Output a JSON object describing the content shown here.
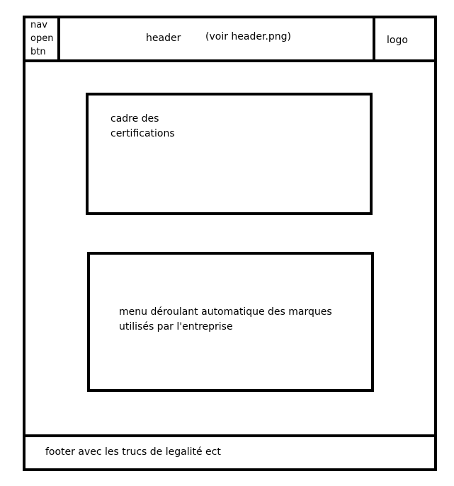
{
  "nav_button": {
    "label": "nav\nopen\nbtn"
  },
  "header": {
    "label": "header",
    "note": "(voir header.png)"
  },
  "logo": {
    "label": "logo"
  },
  "certifications": {
    "label": "cadre des\ncertifications"
  },
  "brands_menu": {
    "label": "menu déroulant automatique des marques\nutilisés par l'entreprise"
  },
  "footer": {
    "label": "footer avec les trucs de legalité ect"
  },
  "colors": {
    "stroke": "#000000",
    "background": "#ffffff"
  }
}
